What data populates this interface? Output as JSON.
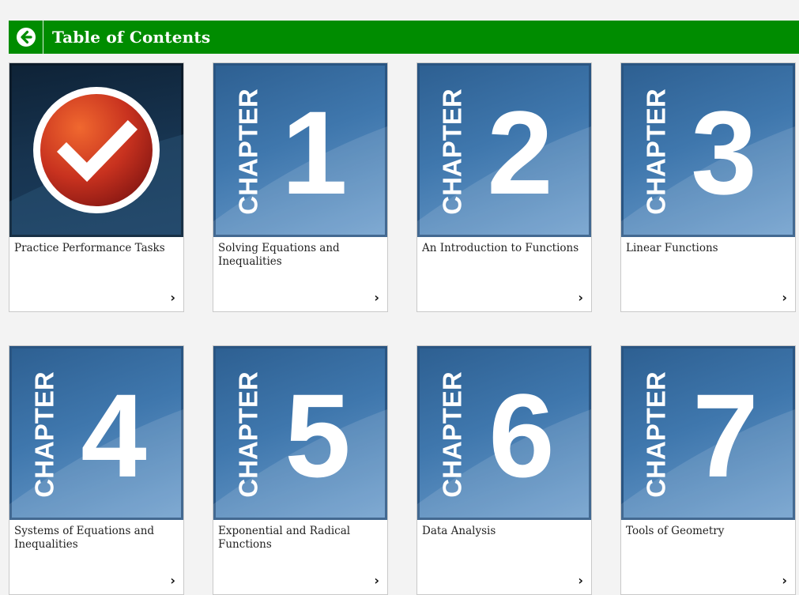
{
  "header": {
    "title": "Table of Contents",
    "back_icon": "circle-arrow-left-icon",
    "color": "#008c00"
  },
  "cards": [
    {
      "title": "Practice Performance Tasks",
      "icon": "checkmark-badge-icon"
    },
    {
      "title": "Solving Equations and Inequalities",
      "chapter_word": "CHAPTER",
      "number": "1"
    },
    {
      "title": "An Introduction to Functions",
      "chapter_word": "CHAPTER",
      "number": "2"
    },
    {
      "title": "Linear Functions",
      "chapter_word": "CHAPTER",
      "number": "3"
    },
    {
      "title": "Systems of Equations and Inequalities",
      "chapter_word": "CHAPTER",
      "number": "4"
    },
    {
      "title": "Exponential and Radical Functions",
      "chapter_word": "CHAPTER",
      "number": "5"
    },
    {
      "title": "Data Analysis",
      "chapter_word": "CHAPTER",
      "number": "6"
    },
    {
      "title": "Tools of Geometry",
      "chapter_word": "CHAPTER",
      "number": "7"
    }
  ],
  "chevron_glyph": "›"
}
